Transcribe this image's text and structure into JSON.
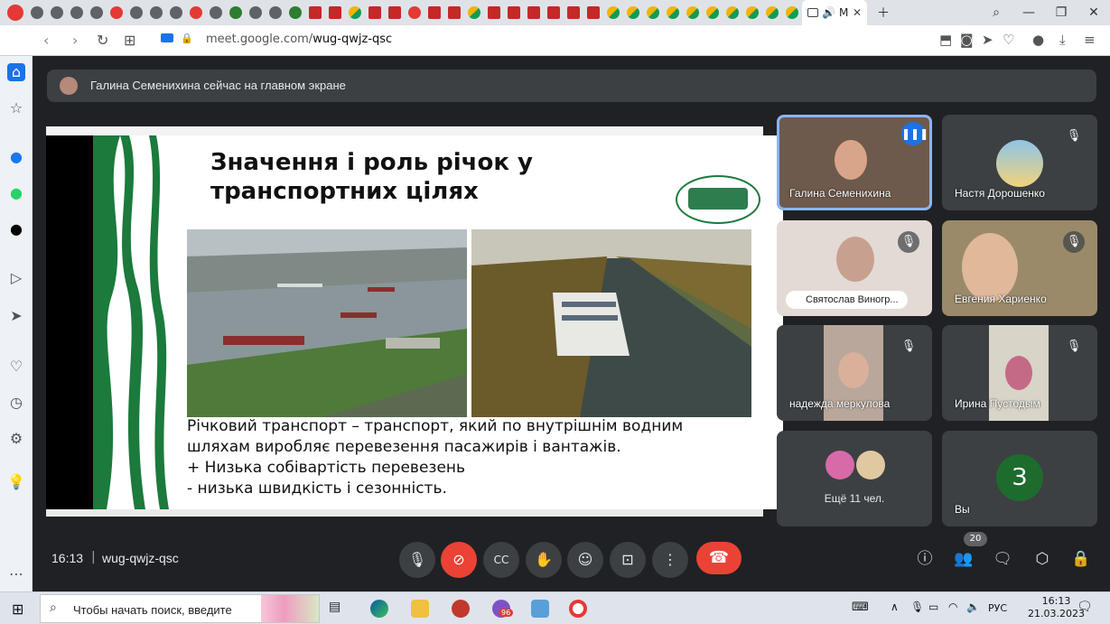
{
  "browser": {
    "active_tab_label": "M",
    "url_prefix": "meet.google.com/",
    "url_path": "wug-qwjz-qsc"
  },
  "banner": {
    "text": "Галина Семенихина сейчас на главном экране"
  },
  "slide": {
    "title_line1": "Значення і роль річок у",
    "title_line2": "транспортних цілях",
    "body_line1": "Річковий  транспорт – транспорт, який по внутрішнім водним",
    "body_line2": "шляхам виробляє перевезення пасажирів і вантажів.",
    "body_line3": "+ Низька собівартість перевезень",
    "body_line4": "- низька швидкість і сезонність."
  },
  "participants": [
    {
      "name": "Галина Семенихина",
      "speaking": true
    },
    {
      "name": "Настя Дорошенко",
      "speaking": false
    },
    {
      "name": "Святослав Виногр...",
      "speaking": false
    },
    {
      "name": "Евгения Хариенко",
      "speaking": false
    },
    {
      "name": "надежда меркулова",
      "speaking": false
    },
    {
      "name": "Ирина Пустодым",
      "speaking": false
    }
  ],
  "more_tile": {
    "label": "Ещё 11 чел."
  },
  "you_tile": {
    "initial": "З",
    "label": "Вы"
  },
  "controls": {
    "time": "16:13",
    "separator": "|",
    "meeting_code": "wug-qwjz-qsc",
    "people_count": "20"
  },
  "taskbar": {
    "search_placeholder": "Чтобы начать поиск, введите",
    "opera_badge": "96",
    "language": "РУС",
    "time": "16:13",
    "date": "21.03.2023"
  },
  "colors": {
    "meet_bg": "#202124",
    "tile_bg": "#3c4043",
    "hangup": "#ea4335",
    "speaking_outline": "#8ab4f8",
    "you_avatar": "#1e6b2e"
  }
}
